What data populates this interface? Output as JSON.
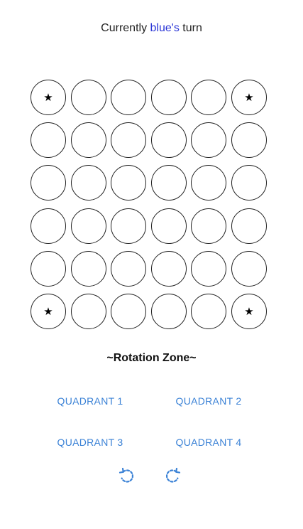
{
  "header": {
    "prefix": "Currently ",
    "player": "blue's",
    "suffix": " turn",
    "player_color": "#2a35d6"
  },
  "board": {
    "rows": 6,
    "cols": 6,
    "cells": [
      [
        "★",
        "",
        "",
        "",
        "",
        "★"
      ],
      [
        "",
        "",
        "",
        "",
        "",
        ""
      ],
      [
        "",
        "",
        "",
        "",
        "",
        ""
      ],
      [
        "",
        "",
        "",
        "",
        "",
        ""
      ],
      [
        "",
        "",
        "",
        "",
        "",
        ""
      ],
      [
        "★",
        "",
        "",
        "",
        "",
        "★"
      ]
    ]
  },
  "rotation": {
    "title": "~Rotation Zone~",
    "quadrants": [
      "QUADRANT 1",
      "QUADRANT 2",
      "QUADRANT 3",
      "QUADRANT 4"
    ],
    "rotate_left_icon": "rotate-counterclockwise-icon",
    "rotate_right_icon": "rotate-clockwise-icon",
    "button_color": "#3b82d6"
  }
}
